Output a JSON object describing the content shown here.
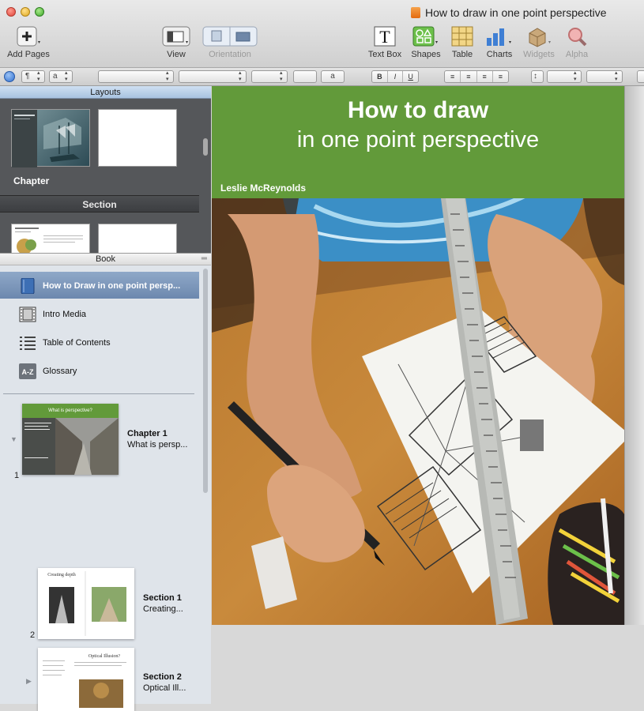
{
  "window": {
    "title": "How to draw in one point perspective"
  },
  "toolbar": {
    "add_pages": "Add Pages",
    "view": "View",
    "orientation": "Orientation",
    "text_box": "Text Box",
    "shapes": "Shapes",
    "table": "Table",
    "charts": "Charts",
    "widgets": "Widgets",
    "alpha": "Alpha"
  },
  "formatbar": {
    "paragraph_style": "¶",
    "char_style": "a",
    "text_color_label": "a",
    "bold": "B",
    "italic": "I",
    "underline": "U"
  },
  "sidebar": {
    "layouts_header": "Layouts",
    "layout_chapter_label": "Chapter",
    "section_header": "Section",
    "book_header": "Book",
    "items": [
      {
        "label": "How to Draw in one point persp..."
      },
      {
        "label": "Intro Media"
      },
      {
        "label": "Table of Contents"
      },
      {
        "label": "Glossary"
      }
    ],
    "pages": [
      {
        "num": "1",
        "title": "Chapter 1",
        "subtitle": "What is persp...",
        "thumb_heading": "What is perspective?"
      },
      {
        "num": "2",
        "title": "Section 1",
        "subtitle": "Creating...",
        "thumb_heading": "Creating depth"
      },
      {
        "num": "",
        "title": "Section 2",
        "subtitle": "Optical Ill...",
        "thumb_heading": "Optical Illusion?"
      }
    ]
  },
  "page": {
    "title": "How to draw",
    "subtitle": "in one point perspective",
    "author": "Leslie McReynolds",
    "banner_color": "#629a3a"
  }
}
